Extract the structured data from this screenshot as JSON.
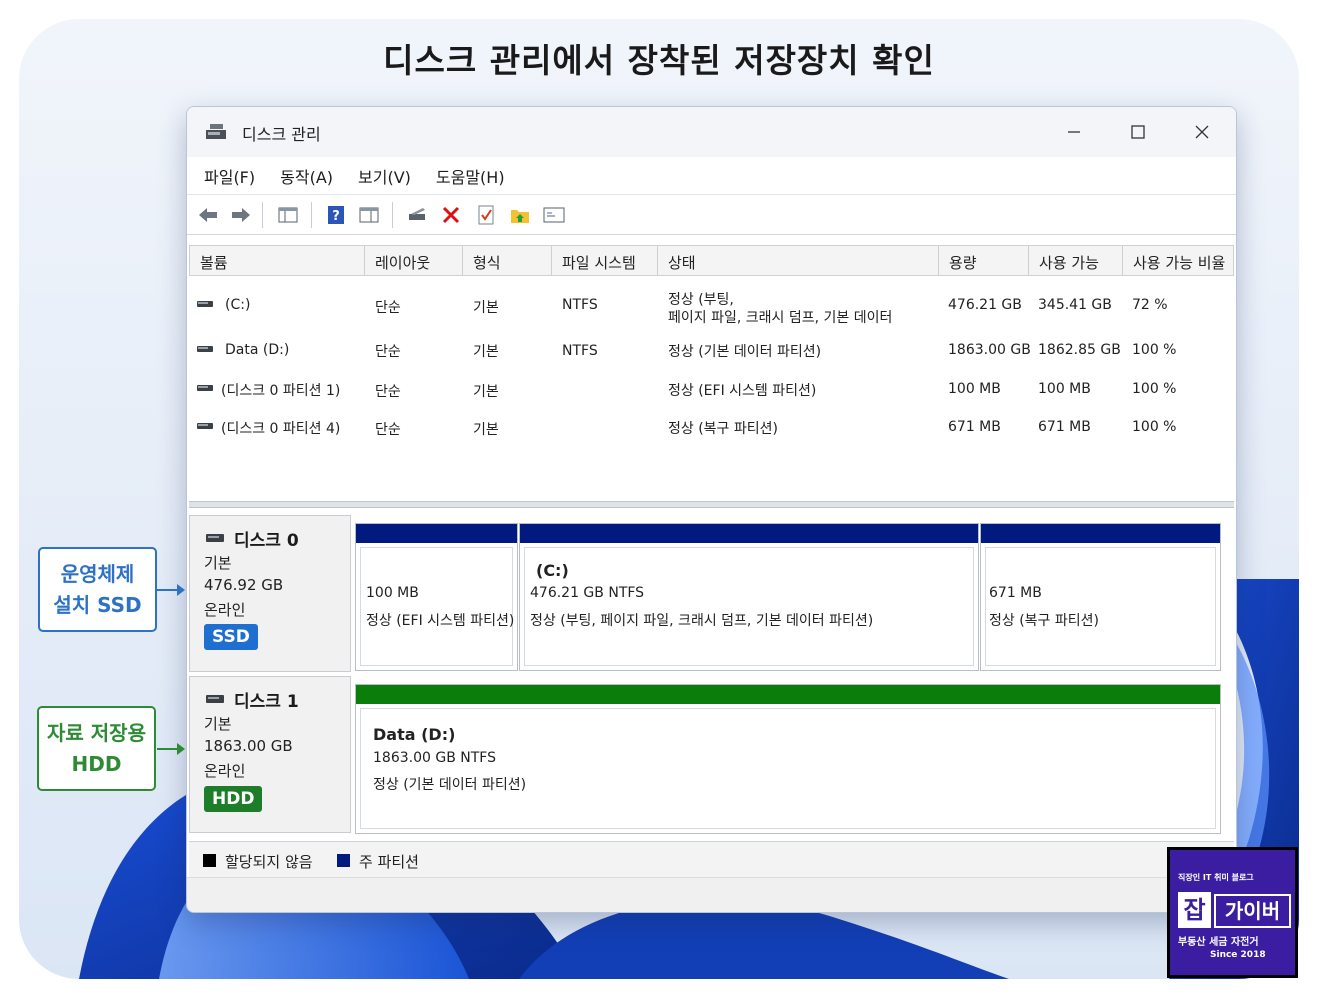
{
  "headline": "디스크 관리에서 장착된 저장장치 확인",
  "window": {
    "title": "디스크 관리"
  },
  "menu": [
    "파일(F)",
    "동작(A)",
    "보기(V)",
    "도움말(H)"
  ],
  "toolbar_icons": [
    "back-arrow-icon",
    "forward-arrow-icon",
    "console-tree-icon",
    "help-icon",
    "properties-icon",
    "connect-disk-icon",
    "delete-icon",
    "checkmark-icon",
    "folder-up-icon",
    "console-icon"
  ],
  "volume_table": {
    "headers": [
      "볼륨",
      "레이아웃",
      "형식",
      "파일 시스템",
      "상태",
      "용량",
      "사용 가능",
      "사용 가능 비율"
    ],
    "rows": [
      {
        "volume": "(C:)",
        "layout": "단순",
        "type": "기본",
        "fs": "NTFS",
        "status1": "정상 (부팅,",
        "status2": "페이지 파일, 크래시 덤프, 기본 데이터",
        "capacity": "476.21 GB",
        "free": "345.41 GB",
        "pct": "72 %"
      },
      {
        "volume": "Data (D:)",
        "layout": "단순",
        "type": "기본",
        "fs": "NTFS",
        "status1": "정상 (기본 데이터 파티션)",
        "status2": "",
        "capacity": "1863.00 GB",
        "free": "1862.85 GB",
        "pct": "100 %"
      },
      {
        "volume": "(디스크 0 파티션 1)",
        "layout": "단순",
        "type": "기본",
        "fs": "",
        "status1": "정상 (EFI 시스템 파티션)",
        "status2": "",
        "capacity": "100 MB",
        "free": "100 MB",
        "pct": "100 %"
      },
      {
        "volume": "(디스크 0 파티션 4)",
        "layout": "단순",
        "type": "기본",
        "fs": "",
        "status1": "정상 (복구 파티션)",
        "status2": "",
        "capacity": "671 MB",
        "free": "671 MB",
        "pct": "100 %"
      }
    ]
  },
  "disks": [
    {
      "name": "디스크 0",
      "kind": "기본",
      "size": "476.92 GB",
      "state": "온라인",
      "badge": "SSD",
      "partitions": [
        {
          "name": "",
          "line1": "100 MB",
          "line2": "정상 (EFI 시스템 파티션)"
        },
        {
          "name": "(C:)",
          "line1": "476.21 GB NTFS",
          "line2": "정상 (부팅, 페이지 파일, 크래시 덤프, 기본 데이터 파티션)"
        },
        {
          "name": "",
          "line1": "671 MB",
          "line2": "정상 (복구 파티션)"
        }
      ]
    },
    {
      "name": "디스크 1",
      "kind": "기본",
      "size": "1863.00 GB",
      "state": "온라인",
      "badge": "HDD",
      "partitions": [
        {
          "name": "Data  (D:)",
          "line1": "1863.00 GB NTFS",
          "line2": "정상 (기본 데이터 파티션)"
        }
      ]
    }
  ],
  "legend": {
    "unallocated": "할당되지 않음",
    "primary": "주 파티션"
  },
  "callouts": {
    "ssd_line1": "운영체제",
    "ssd_line2": "설치 SSD",
    "hdd_line1": "자료 저장용",
    "hdd_line2": "HDD"
  },
  "logo": {
    "line1": "직장인 IT 취미 블로그",
    "box1": "잡",
    "box2": "가이버",
    "line2": "부동산 세금 자전거",
    "line3": "Since 2018"
  },
  "colors": {
    "primary_partition": "#001a80",
    "data_partition": "#0a7d0a",
    "ssd_badge": "#1f6fd0",
    "hdd_badge": "#1e7d28",
    "accent_blue": "#2d72c4",
    "accent_green": "#2e8b35",
    "logo_bg": "#3a1da0"
  }
}
